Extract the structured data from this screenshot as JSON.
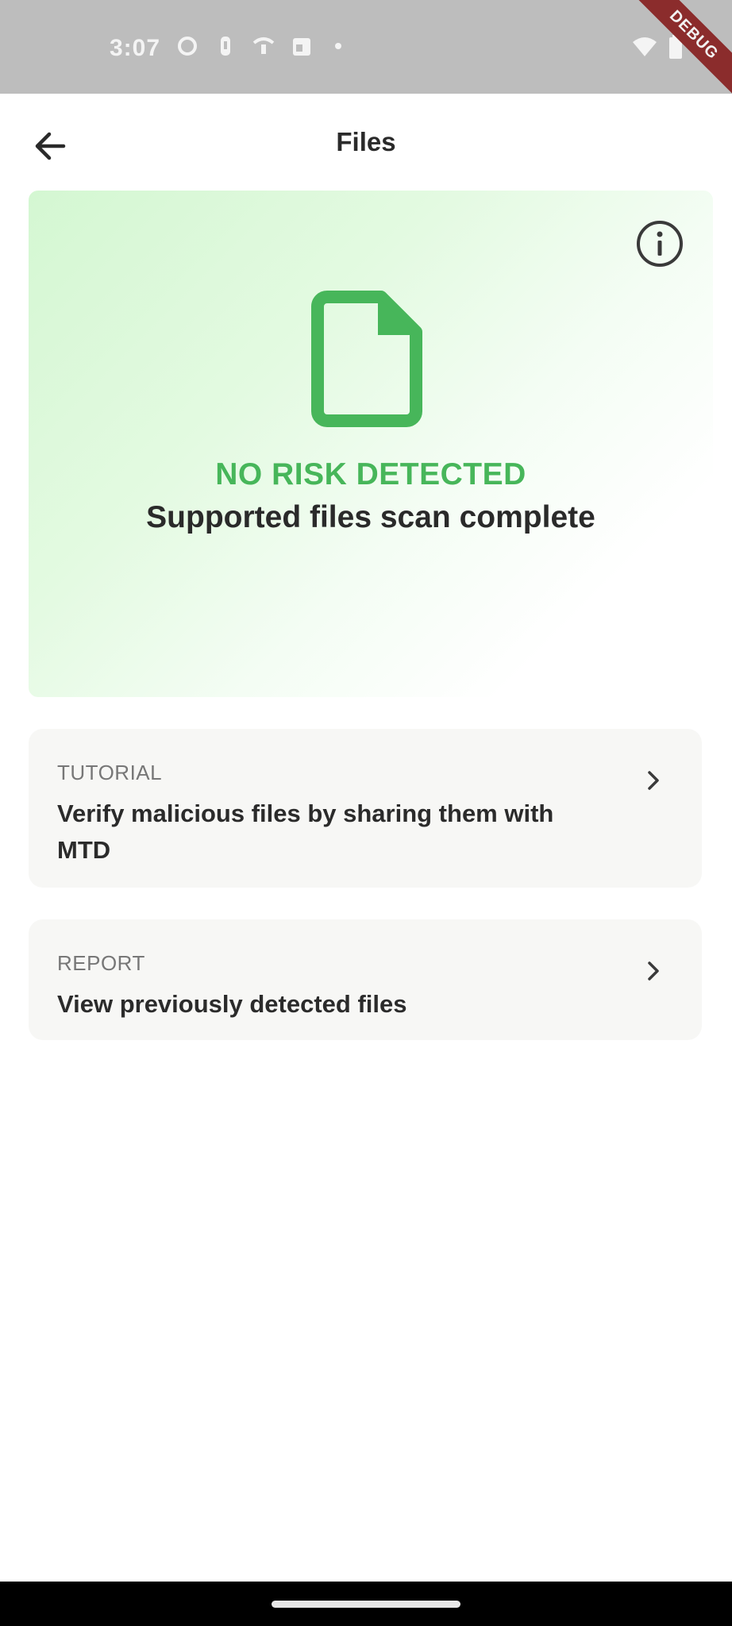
{
  "status_bar": {
    "time": "3:07",
    "debug_label": "DEBUG",
    "left_icons": [
      "sync-icon",
      "alert-icon",
      "cast-icon",
      "calendar-icon"
    ],
    "right_icons": [
      "wifi-icon",
      "battery-icon"
    ]
  },
  "app_bar": {
    "title": "Files",
    "back_icon": "arrow-left-icon"
  },
  "hero": {
    "heading": "NO RISK DETECTED",
    "subheading": "Supported files scan complete",
    "status_color": "#47b65a",
    "icon": "file-icon",
    "info_icon": "info-icon"
  },
  "cards": [
    {
      "kicker": "TUTORIAL",
      "title": "Verify malicious files by sharing them with MTD",
      "icon": "chevron-right-icon"
    },
    {
      "kicker": "REPORT",
      "title": "View previously detected files",
      "icon": "chevron-right-icon"
    }
  ],
  "colors": {
    "accent_green": "#47b65a",
    "card_background": "#f7f7f5",
    "status_bar": "#bdbdbd",
    "debug_banner": "#8b2c2c"
  }
}
